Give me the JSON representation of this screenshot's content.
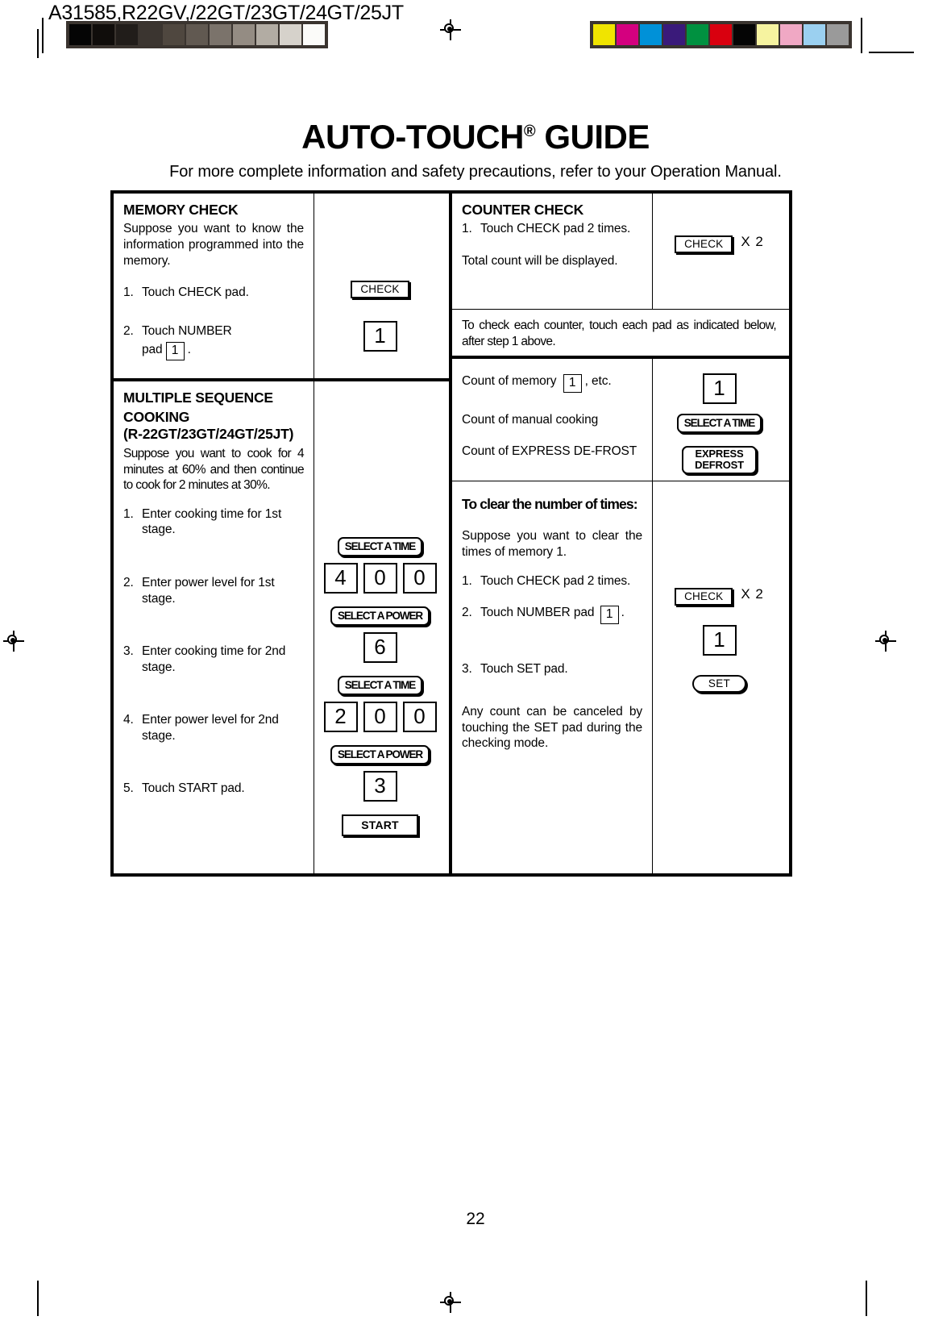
{
  "registration": {
    "plate_code": "A31585,R22GV,/22GT/23GT/24GT/25JT",
    "gray_ramp": [
      "#050505",
      "#100d0b",
      "#211d1a",
      "#3b3530",
      "#4f473f",
      "#615951",
      "#7b736b",
      "#948c83",
      "#b2aca3",
      "#d6d2cb",
      "#fbfbf9"
    ],
    "color_ramp": [
      "#f0e400",
      "#d4007f",
      "#0091d8",
      "#3a1a7a",
      "#009140",
      "#d9000f",
      "#050505",
      "#f6f3a0",
      "#f0a8c4",
      "#9bd0f0",
      "#9a9a9a"
    ]
  },
  "header": {
    "title": "AUTO-TOUCH",
    "title_sup": "®",
    "title_tail": " GUIDE",
    "subtitle": "For more complete information and safety precautions, refer to your Operation Manual."
  },
  "memory_check": {
    "heading": "MEMORY CHECK",
    "intro": "Suppose you want to know the information programmed into the memory.",
    "step1_num": "1.",
    "step1_text": "Touch CHECK pad.",
    "step2_num": "2.",
    "step2_text": "Touch NUMBER",
    "step2_text2_pre": "pad",
    "step2_text2_post": ".",
    "step2_digit": "1",
    "pad_check": "CHECK",
    "pad_digit": "1"
  },
  "counter_check": {
    "heading": "COUNTER CHECK",
    "step1_num": "1.",
    "step1_text": "Touch CHECK pad 2 times.",
    "note": "Total count will be displayed.",
    "pad_check": "CHECK",
    "pad_multiplier": "X 2",
    "banner": "To check each counter, touch each pad as indicated below, after step 1 above."
  },
  "counter_list": {
    "row1_pre": "Count of memory",
    "row1_digit": "1",
    "row1_post": ", etc.",
    "row2": "Count of manual cooking",
    "row3": "Count of EXPRESS DE-FROST",
    "pad_digit": "1",
    "pad_select_time": "SELECT A TIME",
    "pad_express_line1": "EXPRESS",
    "pad_express_line2": "DEFROST"
  },
  "multiple_sequence": {
    "heading_line1": "MULTIPLE SEQUENCE",
    "heading_line2": "COOKING",
    "heading_line3": "(R-22GT/23GT/24GT/25JT)",
    "intro": "Suppose you want to cook for 4 minutes at 60% and then continue to cook for 2 minutes at 30%.",
    "steps": [
      {
        "num": "1.",
        "text": "Enter cooking time for 1st stage."
      },
      {
        "num": "2.",
        "text": "Enter power level for 1st stage."
      },
      {
        "num": "3.",
        "text": "Enter cooking time for 2nd stage."
      },
      {
        "num": "4.",
        "text": "Enter power level for 2nd stage."
      },
      {
        "num": "5.",
        "text": "Touch START pad."
      }
    ],
    "pad_select_time": "SELECT A TIME",
    "pad_select_power": "SELECT A POWER",
    "time1_digits": [
      "4",
      "0",
      "0"
    ],
    "power1_digit": "6",
    "time2_digits": [
      "2",
      "0",
      "0"
    ],
    "power2_digit": "3",
    "pad_start": "START"
  },
  "clear_times": {
    "heading": "To clear the number of times:",
    "intro": "Suppose you want to clear the times of memory 1.",
    "step1_num": "1.",
    "step1_text": "Touch CHECK pad 2 times.",
    "step2_num": "2.",
    "step2_text_pre": "Touch NUMBER pad",
    "step2_digit": "1",
    "step2_text_post": ".",
    "step3_num": "3.",
    "step3_text": "Touch SET pad.",
    "footer": "Any count can be canceled by  touching the SET pad during the checking mode.",
    "pad_check": "CHECK",
    "pad_multiplier": "X 2",
    "pad_digit": "1",
    "pad_set": "SET"
  },
  "footer": {
    "page_number": "22"
  }
}
